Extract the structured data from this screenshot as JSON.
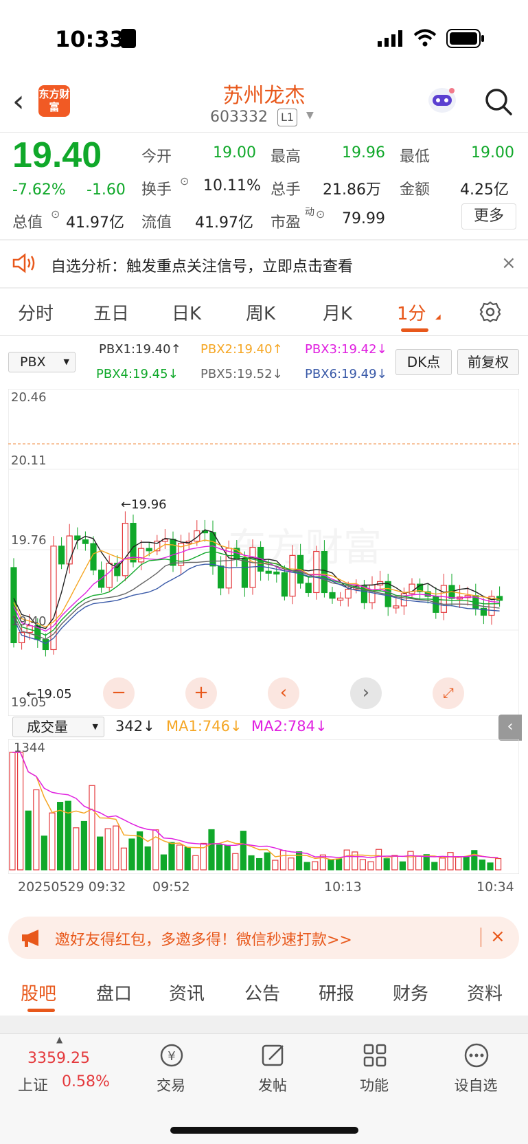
{
  "status": {
    "time": "10:33"
  },
  "header": {
    "name": "苏州龙杰",
    "code": "603332",
    "level": "L1",
    "logo": "东方财富"
  },
  "quote": {
    "price": "19.40",
    "change_pct": "-7.62%",
    "change": "-1.60",
    "open_label": "今开",
    "open": "19.00",
    "high_label": "最高",
    "high": "19.96",
    "low_label": "最低",
    "low": "19.00",
    "turnover_label": "换手",
    "turnover": "10.11%",
    "volume_label": "总手",
    "volume": "21.86万",
    "amount_label": "金额",
    "amount": "4.25亿",
    "mktcap_label": "总值",
    "mktcap": "41.97亿",
    "float_label": "流值",
    "float": "41.97亿",
    "pe_label": "市盈",
    "pe_sup": "动",
    "pe": "79.99",
    "more": "更多"
  },
  "notice": {
    "text": "自选分析：触发重点关注信号，立即点击查看"
  },
  "tabs": [
    "分时",
    "五日",
    "日K",
    "周K",
    "月K",
    "1分"
  ],
  "indicator": {
    "select": "PBX",
    "items": [
      {
        "label": "PBX1:19.40↑",
        "color": "#333333"
      },
      {
        "label": "PBX2:19.40↑",
        "color": "#f5a623"
      },
      {
        "label": "PBX3:19.42↓",
        "color": "#e020e0"
      },
      {
        "label": "PBX4:19.45↓",
        "color": "#10a82a"
      },
      {
        "label": "PBX5:19.52↓",
        "color": "#666666"
      },
      {
        "label": "PBX6:19.49↓",
        "color": "#3a5aa8"
      }
    ],
    "dk": "DK点",
    "fq": "前复权"
  },
  "chart": {
    "ylabels": [
      "20.46",
      "20.11",
      "19.76",
      "19.40",
      "19.05"
    ],
    "high_mark": "←19.96",
    "low_mark": "←19.05"
  },
  "volume": {
    "select": "成交量",
    "value": "342↓",
    "ma1": "MA1:746↓",
    "ma2": "MA2:784↓",
    "max": "1344"
  },
  "time_axis": [
    "20250529 09:32",
    "09:52",
    "10:13",
    "10:34"
  ],
  "promo": {
    "text": "邀好友得红包，多邀多得！微信秒速打款>>"
  },
  "bottom_tabs": [
    "股吧",
    "盘口",
    "资讯",
    "公告",
    "研报",
    "财务",
    "资料"
  ],
  "nav": {
    "index_value": "3359.25",
    "index_name": "上证",
    "index_pct": "0.58%",
    "items": [
      "交易",
      "发帖",
      "功能",
      "设自选"
    ]
  }
}
